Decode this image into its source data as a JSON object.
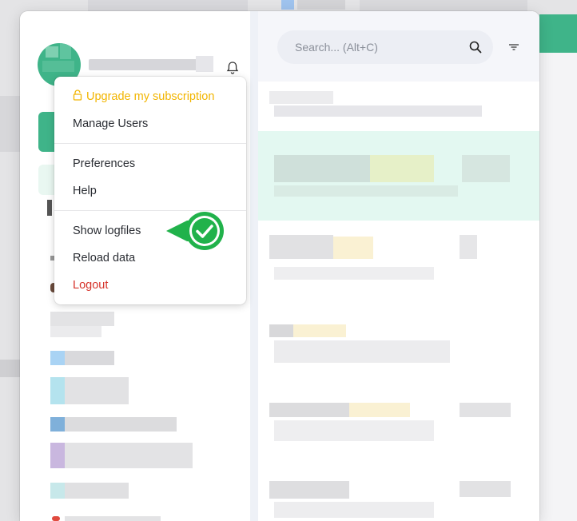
{
  "search": {
    "placeholder": "Search... (Alt+C)"
  },
  "menu": {
    "upgrade_label": "Upgrade my subscription",
    "manage_users_label": "Manage Users",
    "preferences_label": "Preferences",
    "help_label": "Help",
    "show_logfiles_label": "Show logfiles",
    "reload_data_label": "Reload data",
    "logout_label": "Logout"
  },
  "colors": {
    "accent_green": "#3fb489",
    "upgrade_gold": "#f2b500",
    "logout_red": "#d6332a",
    "callout_green": "#21b24b"
  },
  "icons": {
    "search": "search-icon",
    "filter": "filter-icon",
    "bell": "bell-icon",
    "lock": "lock-icon",
    "check": "check-icon"
  }
}
